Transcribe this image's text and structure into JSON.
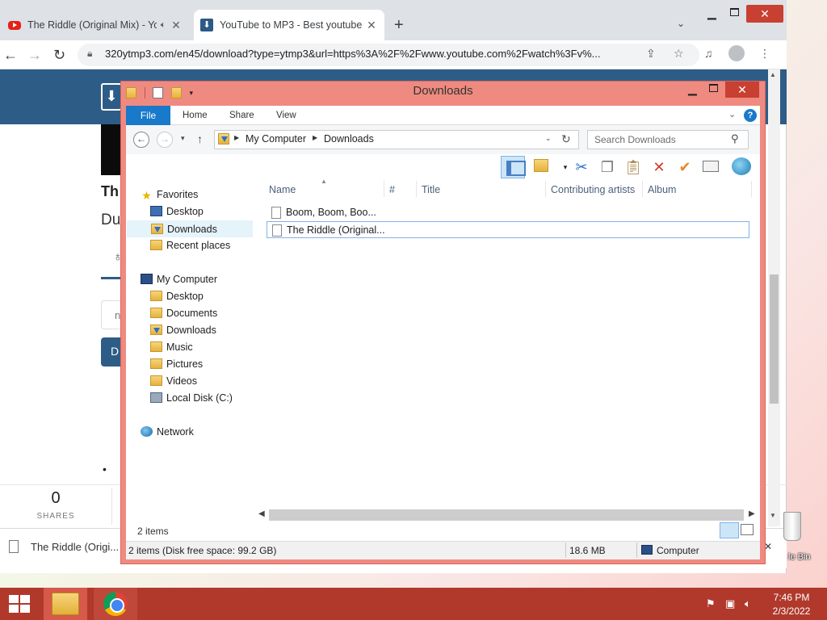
{
  "browser": {
    "tabs": [
      {
        "title": "The Riddle (Original Mix) - YouTube",
        "icon": "youtube-icon"
      },
      {
        "title": "YouTube to MP3 - Best youtube to mp3 converter",
        "icon": "download-site-icon"
      }
    ],
    "url": "320ytmp3.com/en45/download?type=ytmp3&url=https%3A%2F%2Fwww.youtube.com%2Fwatch%3Fv%...",
    "page": {
      "heading_fragment": "Th",
      "sub_fragment": "Du",
      "input_fragment": "n",
      "button_fragment": "D",
      "shares_count": "0",
      "shares_label": "SHARES"
    },
    "download_shelf": {
      "filename": "The Riddle (Origi..."
    }
  },
  "explorer": {
    "title": "Downloads",
    "ribbon_tabs": [
      "File",
      "Home",
      "Share",
      "View"
    ],
    "breadcrumb": [
      "My Computer",
      "Downloads"
    ],
    "search_placeholder": "Search Downloads",
    "nav": {
      "favorites_label": "Favorites",
      "favorites": [
        "Desktop",
        "Downloads",
        "Recent places"
      ],
      "computer_label": "My Computer",
      "computer": [
        "Desktop",
        "Documents",
        "Downloads",
        "Music",
        "Pictures",
        "Videos",
        "Local Disk (C:)"
      ],
      "network_label": "Network"
    },
    "columns": [
      "Name",
      "#",
      "Title",
      "Contributing artists",
      "Album"
    ],
    "files": [
      {
        "name": "Boom, Boom, Boo...",
        "selected": false
      },
      {
        "name": "The Riddle (Original...",
        "selected": true
      }
    ],
    "item_count": "2 items",
    "details": {
      "summary": "2 items (Disk free space: 99.2 GB)",
      "size": "18.6 MB",
      "location": "Computer"
    }
  },
  "desktop": {
    "recycle_bin_label": "le Bin"
  },
  "taskbar": {
    "time": "7:46 PM",
    "date": "2/3/2022"
  },
  "colors": {
    "accent_blue": "#1979ca",
    "window_border": "#ef8a80",
    "taskbar": "#b0392c",
    "site_header": "#2d5d87"
  }
}
